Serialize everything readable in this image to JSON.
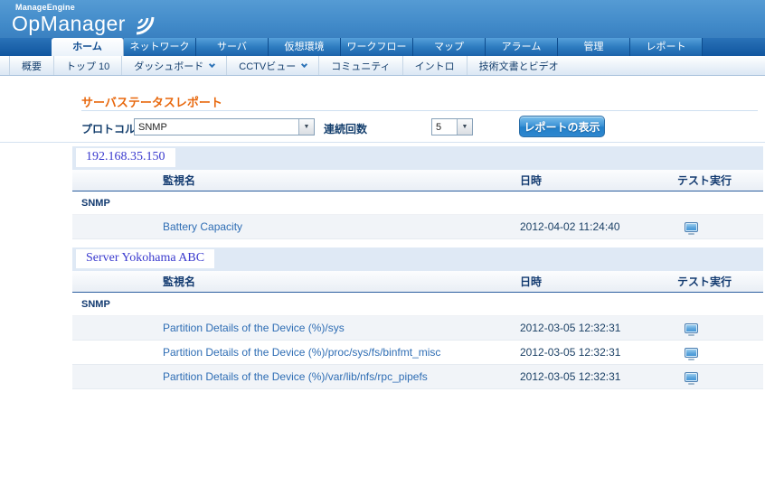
{
  "brand": {
    "company": "ManageEngine",
    "product": "OpManager"
  },
  "nav": {
    "tabs": [
      {
        "label": "ホーム",
        "active": true
      },
      {
        "label": "ネットワーク",
        "active": false
      },
      {
        "label": "サーバ",
        "active": false
      },
      {
        "label": "仮想環境",
        "active": false
      },
      {
        "label": "ワークフロー",
        "active": false
      },
      {
        "label": "マップ",
        "active": false
      },
      {
        "label": "アラーム",
        "active": false
      },
      {
        "label": "管理",
        "active": false
      },
      {
        "label": "レポート",
        "active": false
      }
    ]
  },
  "subnav": {
    "items": [
      {
        "label": "概要",
        "dropdown": false
      },
      {
        "label": "トップ 10",
        "dropdown": false
      },
      {
        "label": "ダッシュボード",
        "dropdown": true
      },
      {
        "label": "CCTVビュー",
        "dropdown": true
      },
      {
        "label": "コミュニティ",
        "dropdown": false
      },
      {
        "label": "イントロ",
        "dropdown": false
      },
      {
        "label": "技術文書とビデオ",
        "dropdown": false
      }
    ]
  },
  "page": {
    "title": "サーバステータスレポート"
  },
  "form": {
    "protocol_label": "プロトコル",
    "protocol_value": "SNMP",
    "count_label": "連続回数",
    "count_value": "5",
    "submit_label": "レポートの表示"
  },
  "table": {
    "columns": {
      "monitor": "監視名",
      "datetime": "日時",
      "test": "テスト実行"
    }
  },
  "sections": [
    {
      "device": "192.168.35.150",
      "group": "SNMP",
      "rows": [
        {
          "monitor": "Battery Capacity",
          "datetime": "2012-04-02 11:24:40"
        }
      ]
    },
    {
      "device": "Server Yokohama ABC",
      "group": "SNMP",
      "rows": [
        {
          "monitor": "Partition Details of the Device (%)/sys",
          "datetime": "2012-03-05 12:32:31"
        },
        {
          "monitor": "Partition Details of the Device (%)/proc/sys/fs/binfmt_misc",
          "datetime": "2012-03-05 12:32:31"
        },
        {
          "monitor": "Partition Details of the Device (%)/var/lib/nfs/rpc_pipefs",
          "datetime": "2012-03-05 12:32:31"
        }
      ]
    }
  ],
  "icons": {
    "dropdown_arrow_glyph": "▼",
    "test_run": "monitor-icon",
    "subnav_expander": "chevron-down-icon",
    "logo_mark": "swoosh-arcs"
  },
  "colors": {
    "header_blue": "#4a92cc",
    "navbar_blue": "#10569f",
    "tab_active_text": "#0d4a8f",
    "accent_orange": "#e8690f",
    "label_navy": "#16406e",
    "link_blue": "#2e6db4",
    "button_blue": "#2f8ad0",
    "section_bar_blue": "#dfe9f5",
    "device_text_blue": "#3a3ace",
    "row_shade": "#f1f4f8"
  }
}
